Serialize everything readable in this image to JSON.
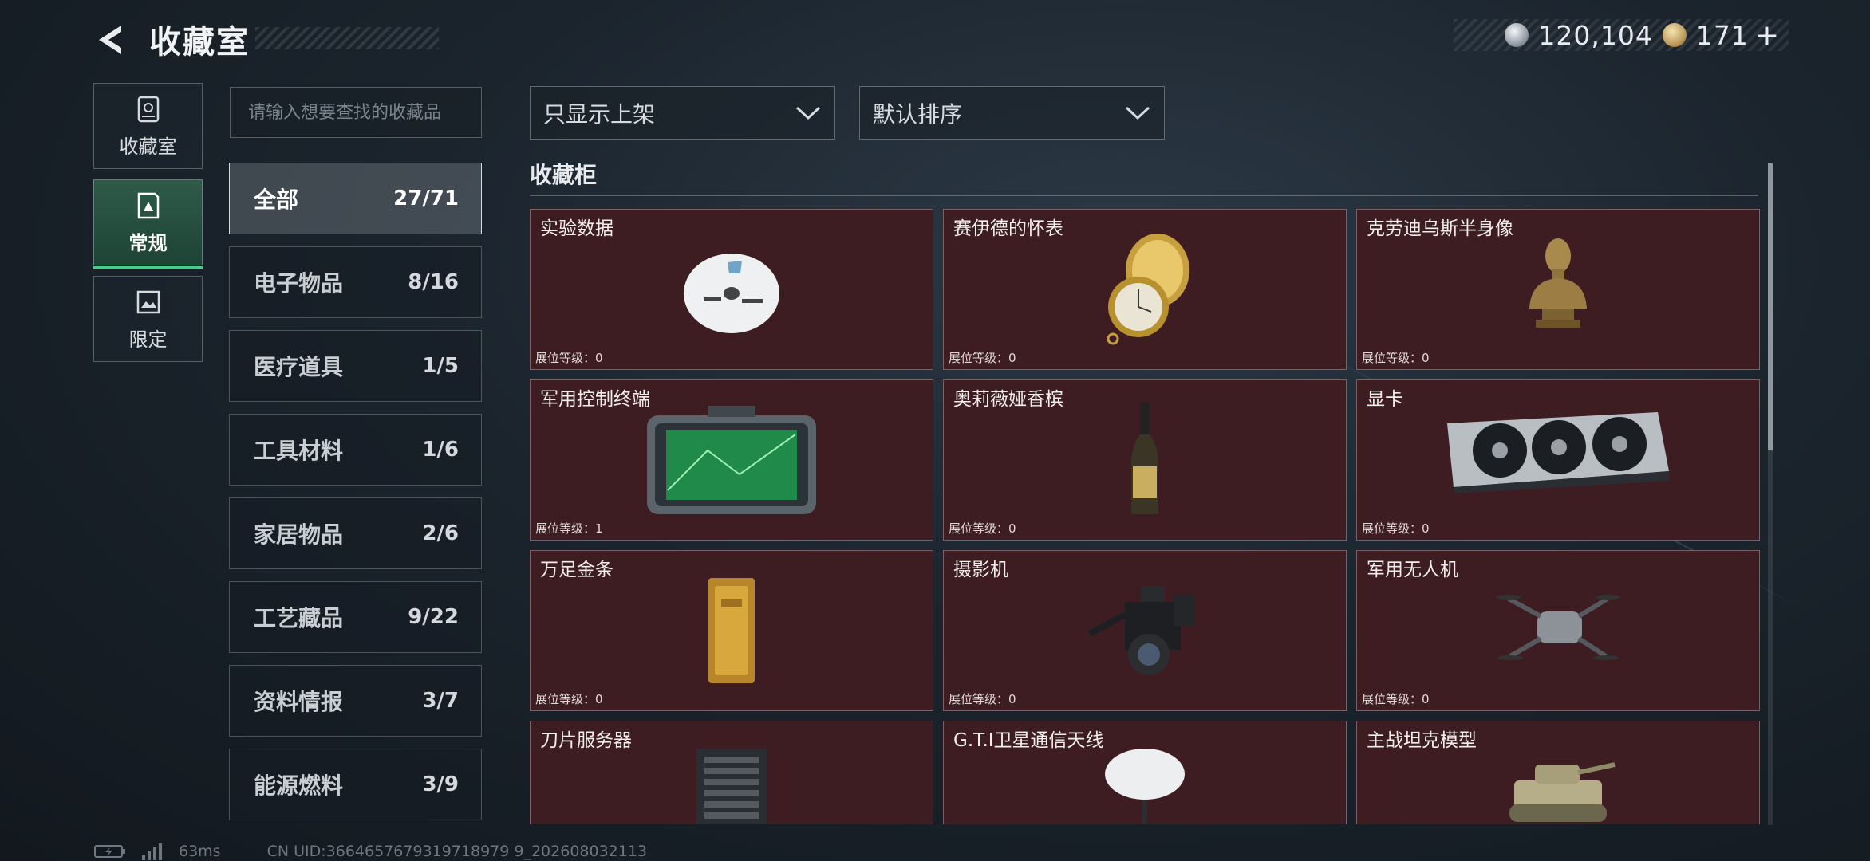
{
  "header": {
    "title": "收藏室",
    "currency": [
      {
        "icon": "silver-coin-icon",
        "value": "120,104"
      },
      {
        "icon": "gold-coin-icon",
        "value": "171"
      }
    ],
    "plus": "+"
  },
  "rail": [
    {
      "label": "收藏室",
      "icon": "safe-icon",
      "active": false
    },
    {
      "label": "常规",
      "icon": "display-case-icon",
      "active": true
    },
    {
      "label": "限定",
      "icon": "picture-frame-icon",
      "active": false
    }
  ],
  "search": {
    "placeholder": "请输入想要查找的收藏品",
    "value": ""
  },
  "categories": [
    {
      "name": "全部",
      "count": "27/71",
      "active": true
    },
    {
      "name": "电子物品",
      "count": "8/16"
    },
    {
      "name": "医疗道具",
      "count": "1/5"
    },
    {
      "name": "工具材料",
      "count": "1/6"
    },
    {
      "name": "家居物品",
      "count": "2/6"
    },
    {
      "name": "工艺藏品",
      "count": "9/22"
    },
    {
      "name": "资料情报",
      "count": "3/7"
    },
    {
      "name": "能源燃料",
      "count": "3/9"
    }
  ],
  "filters": {
    "display": "只显示上架",
    "sort": "默认排序"
  },
  "section": {
    "title": "收藏柜"
  },
  "items": [
    {
      "name": "实验数据",
      "level": "展位等级：0",
      "icon": "data-disc-icon"
    },
    {
      "name": "赛伊德的怀表",
      "level": "展位等级：0",
      "icon": "pocket-watch-icon"
    },
    {
      "name": "克劳迪乌斯半身像",
      "level": "展位等级：0",
      "icon": "bust-statue-icon"
    },
    {
      "name": "军用控制终端",
      "level": "展位等级：1",
      "icon": "control-terminal-icon"
    },
    {
      "name": "奥莉薇娅香槟",
      "level": "展位等级：0",
      "icon": "champagne-bottle-icon"
    },
    {
      "name": "显卡",
      "level": "展位等级：0",
      "icon": "graphics-card-icon"
    },
    {
      "name": "万足金条",
      "level": "展位等级：0",
      "icon": "gold-bar-icon"
    },
    {
      "name": "摄影机",
      "level": "展位等级：0",
      "icon": "video-camera-icon"
    },
    {
      "name": "军用无人机",
      "level": "展位等级：0",
      "icon": "drone-icon"
    },
    {
      "name": "刀片服务器",
      "level": "",
      "icon": "blade-server-icon"
    },
    {
      "name": "G.T.I卫星通信天线",
      "level": "",
      "icon": "satellite-dish-icon"
    },
    {
      "name": "主战坦克模型",
      "level": "",
      "icon": "tank-model-icon"
    }
  ],
  "footer": {
    "ping": "63ms",
    "uid": "CN UID:3664657679319718979 9_202608032113"
  },
  "colors": {
    "card_bg": "#3e1d22",
    "active_tab": "#2f5a48",
    "accent_green": "#49c98e"
  }
}
